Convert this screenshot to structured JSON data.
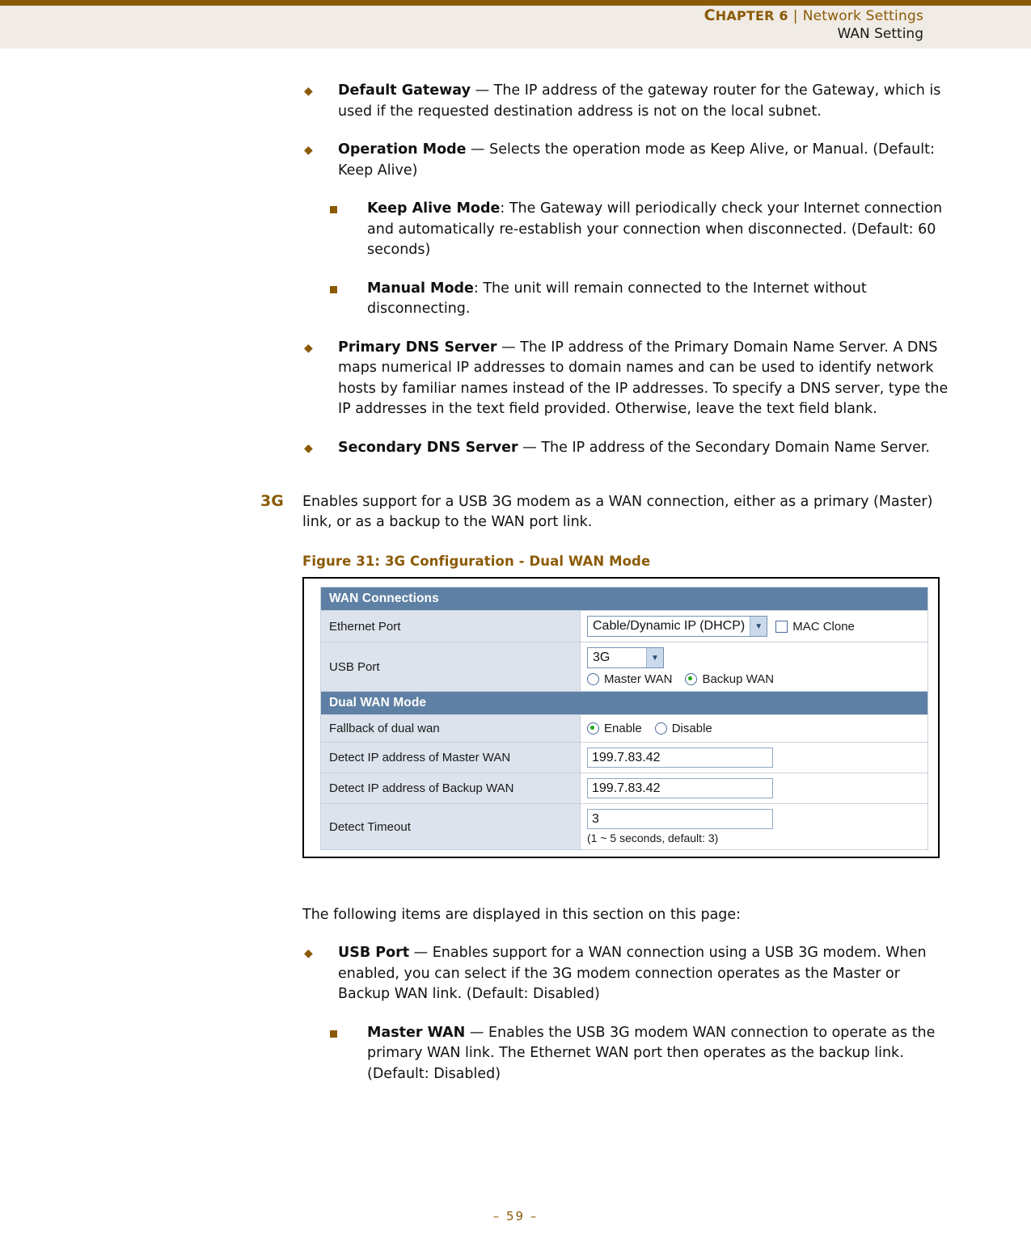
{
  "header": {
    "chapter_prefix": "C",
    "chapter_rest": "HAPTER 6",
    "separator": "|",
    "section": "Network Settings",
    "subsection": "WAN Setting",
    "rule_color": "#8B5A06",
    "background": "#F0EBE4"
  },
  "bullets": [
    {
      "term": "Default Gateway",
      "dash": " — ",
      "text": "The IP address of the gateway router for the Gateway, which is used if the requested destination address is not on the local subnet."
    },
    {
      "term": "Operation Mode",
      "dash": " — ",
      "text": "Selects the operation mode as Keep Alive, or Manual. (Default: Keep Alive)"
    }
  ],
  "subbullets": [
    {
      "term": "Keep Alive Mode",
      "dash": ": ",
      "text": "The Gateway will periodically check your Internet connection and automatically re-establish your connection when disconnected. (Default: 60 seconds)"
    },
    {
      "term": "Manual Mode",
      "dash": ": ",
      "text": "The unit will remain connected to the Internet without disconnecting."
    }
  ],
  "bullets2": [
    {
      "term": "Primary DNS Server",
      "dash": " — ",
      "text": "The IP address of the Primary Domain Name Server. A DNS maps numerical IP addresses to domain names and can be used to identify network hosts by familiar names instead of the IP addresses. To specify a DNS server, type the IP addresses in the text field provided. Otherwise, leave the text field blank."
    },
    {
      "term": "Secondary DNS Server",
      "dash": " — ",
      "text": "The IP address of the Secondary Domain Name Server."
    }
  ],
  "section_3g": {
    "margin_label": "3G",
    "body": "Enables support for a USB 3G modem as a WAN connection, either as a primary (Master) link, or as a backup to the WAN port link.",
    "figure_caption": "Figure 31:  3G Configuration - Dual WAN Mode"
  },
  "figure": {
    "sections": [
      {
        "title": "WAN Connections"
      },
      {
        "title": "Dual WAN Mode"
      }
    ],
    "wan_connections_title": "WAN Connections",
    "dual_wan_title": "Dual WAN Mode",
    "rows": {
      "ethernet_port_label": "Ethernet Port",
      "ethernet_port_value": "Cable/Dynamic IP (DHCP)",
      "mac_clone_label": "MAC Clone",
      "mac_clone_checked": "false",
      "usb_port_label": "USB Port",
      "usb_port_value": "3G",
      "master_wan_label": "Master WAN",
      "backup_wan_label": "Backup WAN",
      "fallback_label": "Fallback of dual wan",
      "enable_label": "Enable",
      "disable_label": "Disable",
      "detect_master_label": "Detect IP address of Master WAN",
      "detect_master_value": "199.7.83.42",
      "detect_backup_label": "Detect IP address of Backup WAN",
      "detect_backup_value": "199.7.83.42",
      "detect_timeout_label": "Detect Timeout",
      "detect_timeout_value": "3",
      "detect_timeout_hint": "(1 ~ 5 seconds, default: 3)"
    },
    "colors": {
      "section_header_bg": "#5E80A4",
      "label_bg": "#DCE3EC",
      "radio_on": "#1aa81a",
      "select_arrow_bg": "#CBD9EC"
    }
  },
  "intro_items": "The following items are displayed in this section on this page:",
  "bullets3": [
    {
      "term": "USB Port",
      "dash": " — ",
      "text": "Enables support for a WAN connection using a USB 3G modem. When enabled, you can select if the 3G modem connection operates as the Master or Backup WAN link. (Default: Disabled)"
    }
  ],
  "subbullets3": [
    {
      "term": "Master WAN",
      "dash": " — ",
      "text": "Enables the USB 3G modem WAN connection to operate as the primary WAN link. The Ethernet WAN port then operates as the backup link. (Default: Disabled)"
    }
  ],
  "footer": {
    "page": "–  59  –"
  }
}
